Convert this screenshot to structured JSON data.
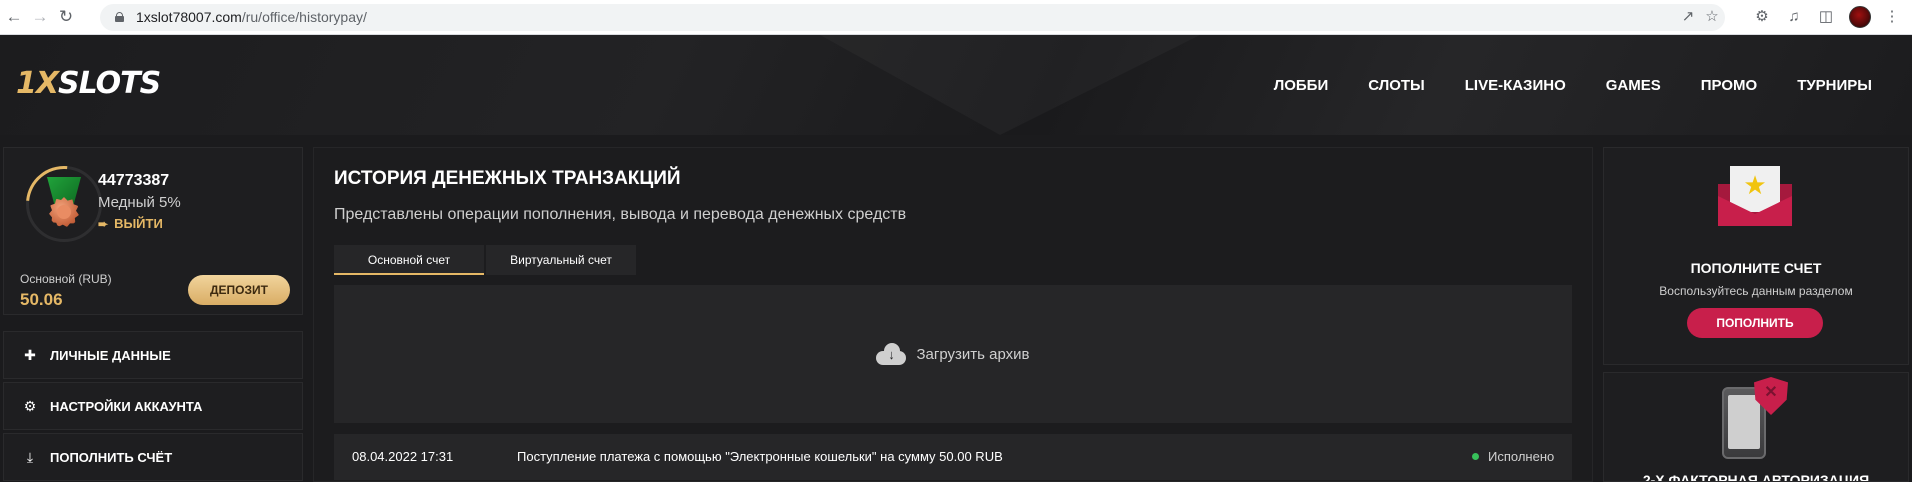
{
  "browser": {
    "url_host": "1xslot78007.com",
    "url_path": "/ru/office/historypay/"
  },
  "header": {
    "logo": {
      "part1": "1X",
      "part2": "SLOTS"
    },
    "nav": [
      "ЛОББИ",
      "СЛОТЫ",
      "LIVE-КАЗИНО",
      "GAMES",
      "ПРОМО",
      "ТУРНИРЫ"
    ]
  },
  "profile": {
    "user_id": "44773387",
    "level": "Медный 5%",
    "logout_label": "ВЫЙТИ",
    "balance_label": "Основной (RUB)",
    "balance_value": "50.06",
    "deposit_label": "ДЕПОЗИТ",
    "level_progress_fraction": 0.12
  },
  "sidebar": {
    "items": [
      {
        "label": "ЛИЧНЫЕ ДАННЫЕ",
        "icon": "user-plus-icon"
      },
      {
        "label": "НАСТРОЙКИ АККАУНТА",
        "icon": "gears-icon"
      },
      {
        "label": "ПОПОЛНИТЬ СЧЁТ",
        "icon": "download-icon"
      }
    ]
  },
  "main": {
    "title": "ИСТОРИЯ ДЕНЕЖНЫХ ТРАНЗАКЦИЙ",
    "subtitle": "Представлены операции пополнения, вывода и перевода денежных средств",
    "tabs": [
      {
        "label": "Основной счет",
        "active": true
      },
      {
        "label": "Виртуальный счет",
        "active": false
      }
    ],
    "upload_label": "Загрузить архив",
    "transactions": [
      {
        "date": "08.04.2022 17:31",
        "description": "Поступление платежа с помощью \"Электронные кошельки\" на сумму 50.00 RUB",
        "status": "Исполнено",
        "status_color": "#37c15a"
      }
    ]
  },
  "right": {
    "promo": {
      "title": "ПОПОЛНИТЕ СЧЕТ",
      "text": "Воспользуйтесь данным разделом",
      "button_label": "ПОПОЛНИТЬ"
    },
    "twofa": {
      "title": "2-Х ФАКТОРНАЯ АВТОРИЗАЦИЯ"
    }
  },
  "colors": {
    "accent_gold": "#e5b866",
    "accent_red": "#c81f4b",
    "status_success": "#37c15a",
    "background": "#1b1b1d"
  }
}
